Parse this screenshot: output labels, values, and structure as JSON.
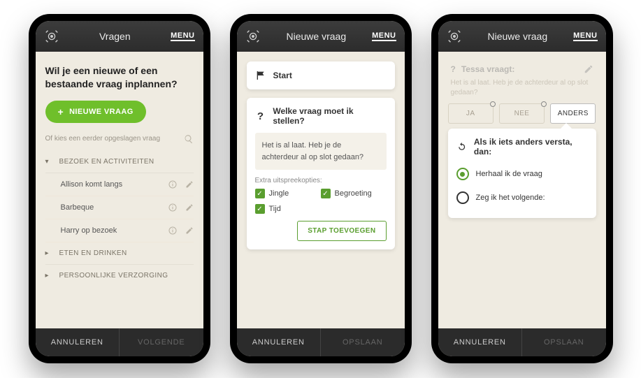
{
  "common": {
    "menu": "MENU"
  },
  "phone1": {
    "title": "Vragen",
    "heading": "Wil je een nieuwe of een bestaande vraag inplannen?",
    "new_button": "NIEUWE VRAAG",
    "saved_note": "Of kies een eerder opgeslagen vraag",
    "cat1": "BEZOEK EN ACTIVITEITEN",
    "items": [
      {
        "label": "Allison komt langs"
      },
      {
        "label": "Barbeque"
      },
      {
        "label": "Harry op bezoek"
      }
    ],
    "cat2": "ETEN EN DRINKEN",
    "cat3": "PERSOONLIJKE VERZORGING",
    "cancel": "ANNULEREN",
    "next": "VOLGENDE"
  },
  "phone2": {
    "title": "Nieuwe vraag",
    "start": "Start",
    "question_title": "Welke vraag moet ik stellen?",
    "question_text": "Het is al laat. Heb je de achterdeur al op slot gedaan?",
    "extra_label": "Extra uitspreekopties:",
    "chk1": "Jingle",
    "chk2": "Begroeting",
    "chk3": "Tijd",
    "add_step": "STAP TOEVOEGEN",
    "cancel": "ANNULEREN",
    "save": "OPSLAAN"
  },
  "phone3": {
    "title": "Nieuwe vraag",
    "asker": "Tessa vraagt:",
    "question_text": "Het is al laat. Heb je de achterdeur al op slot gedaan?",
    "tab_yes": "JA",
    "tab_no": "NEE",
    "tab_other": "ANDERS",
    "card_title": "Als ik iets anders versta, dan:",
    "opt1": "Herhaal ik de vraag",
    "opt2": "Zeg ik het volgende:",
    "cancel": "ANNULEREN",
    "save": "OPSLAAN"
  }
}
